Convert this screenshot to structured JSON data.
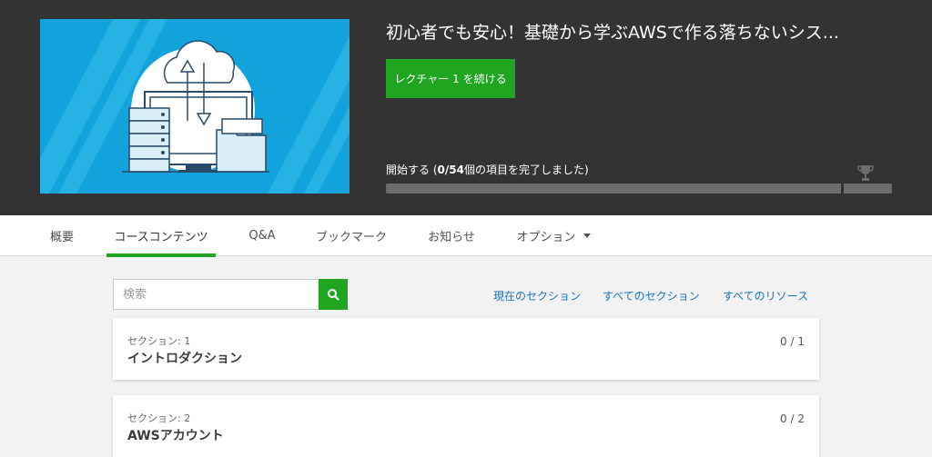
{
  "header": {
    "course_title": "初心者でも安心！基礎から学ぶAWSで作る落ちないシス...",
    "continue_label": "レクチャー 1 を続ける",
    "progress": {
      "prefix": "開始する (",
      "done": "0",
      "separator": "/",
      "total": "54",
      "suffix": "個の項目を完了しました)",
      "fraction": 0
    }
  },
  "tabs": [
    {
      "label": "概要"
    },
    {
      "label": "コースコンテンツ"
    },
    {
      "label": "Q&A"
    },
    {
      "label": "ブックマーク"
    },
    {
      "label": "お知らせ"
    },
    {
      "label": "オプション"
    }
  ],
  "search": {
    "placeholder": "検索",
    "value": ""
  },
  "links": {
    "current_section": "現在のセクション",
    "all_sections": "すべてのセクション",
    "all_resources": "すべてのリソース"
  },
  "sections": [
    {
      "label": "セクション: 1",
      "title": "イントロダクション",
      "progress": "0 / 1"
    },
    {
      "label": "セクション: 2",
      "title": "AWSアカウント",
      "progress": "0 / 2"
    }
  ],
  "colors": {
    "header_bg": "#333333",
    "accent_green": "#1fa51f",
    "link_blue": "#1a73c2",
    "hero_blue": "#1aa3d9",
    "page_bg": "#f2f2f2"
  }
}
